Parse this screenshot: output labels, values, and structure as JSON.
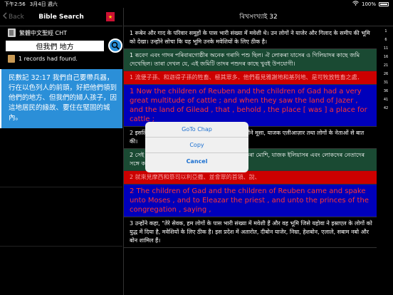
{
  "status": {
    "time": "下午2:56",
    "date": "3月4日 週六",
    "wifi": "WiFi",
    "battery": "100%"
  },
  "left": {
    "back": "Back",
    "title": "Bible Search",
    "version": "繁體中文聖經 CHT",
    "search_value": "但我們 地方",
    "records": "1 records had found.",
    "result": "民數記 32:17 我們自己要帶兵器，行在以色列人的前頭，好把他們領到他們的地方、但我們的婦人孩子，因這地居民的緣故、要住在堅固的城內。"
  },
  "right": {
    "title": "ৰিখসংখ্যাই 32",
    "verses": [
      {
        "cls": "v-black",
        "text": "1 रूबेन और गाद के परिवार समूहों के पास भारी संख्या में मवेशी थे। उन लोगों ने याजेर और गिलाद के समीप की भूमि को देखा। उन्होंने सोचा कि यह भूमि उनके मवेशियों के लिए ठीक है।"
      },
      {
        "cls": "v-green",
        "text": "1 ৰূবেণ এবং গাদৰ পৰিবাৰগোষ্ঠীৰ অনেক গৰাদি পশু ছিল। ঐ লোকৰা যাসেৰ ও গিলিয়াদৰ কাছে জমি দেখেছিল। তাৰা দেখল যে, এই জমিটি তাদৰ পশুদৰ কাছে খুবই উপযোগী।"
      },
      {
        "cls": "v-red",
        "text": "1 流便子孫、和迦得子孫的牲畜、極其眾多．他們看見雅謝地和基列地、是可牧放牲畜之處．"
      },
      {
        "cls": "v-blue",
        "text": "1 Now the children of Reuben and the children of Gad had a very great multitude of cattle ; and when they saw the land of Jazer , and the land of Gilead , that , behold , the place [ was ] a place for cattle ;"
      },
      {
        "cls": "v-black",
        "text": "2 इसलिए रूबेन और गाद के लोग मूसा के पास आए। उन्होंने मूसा, याजक एलीआज़ार तथा लोगों के नेताओं से बात की।"
      },
      {
        "cls": "v-green",
        "text": "2 সেই কাৰণে ৰূবেণ এবং গাদৰ পৰিবাৰগোষ্ঠীৰ লোকৰা মোশি, যাজক ইলিয়াসৰ এবং লোকদেৰ নেতাদেৰ সঙ্গে কথা বলল।"
      },
      {
        "cls": "v-red",
        "text": "2 就來見摩西和祭司以利亞撒、並會眾的首領、說、"
      },
      {
        "cls": "v-blue",
        "text": "2 The children of Gad and the children of Reuben came and spake unto Moses , and to Eleazar the priest , and unto the princes of the congregation , saying ,"
      },
      {
        "cls": "v-black",
        "text": "3 उन्होंने कहा, \"तेरे सेवक, हम लोगों के पास भारी संख्या में मवेशी हैं और वह भूमि जिसे यहोवा ने इस्राएल के लोगों को युद्ध में दिया है, मवेशियों के लिए ठीक है। इस प्रदेश में अतारोत, दीबोन याजेर, निम्रा, हेशबोन, एलाले, सबाम नबो और बोन शामिल हैं।"
      }
    ],
    "index": [
      "1",
      "6",
      "11",
      "16",
      "21",
      "26",
      "31",
      "36",
      "41"
    ],
    "index_tail": "42"
  },
  "dialog": {
    "goto": "GoTo Chap",
    "copy": "Copy",
    "cancel": "Cancel"
  }
}
